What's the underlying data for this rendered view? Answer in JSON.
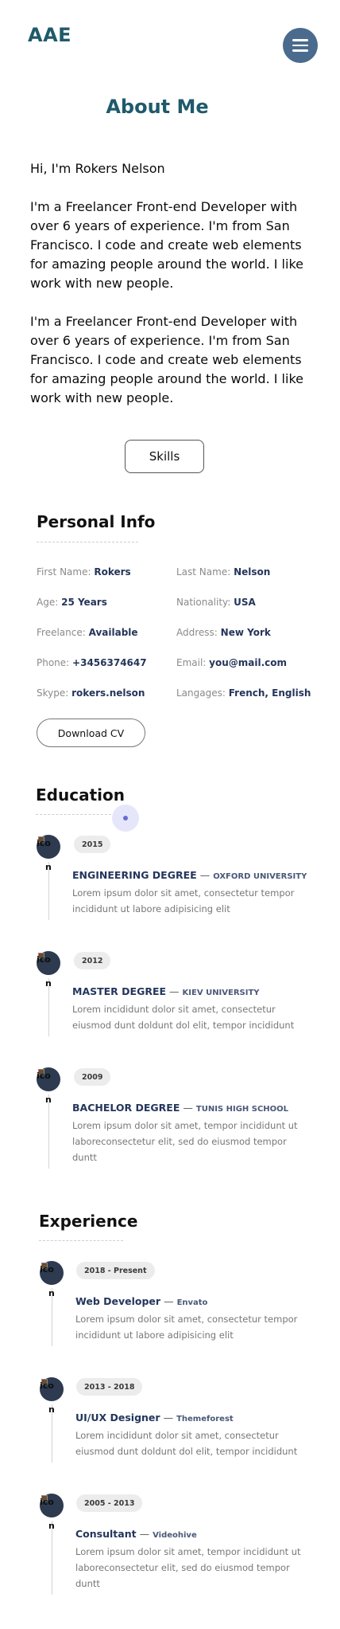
{
  "header": {
    "logo": "AAE",
    "menu_icon": "hamburger-menu-icon"
  },
  "about": {
    "title": "About Me",
    "greeting": "Hi, I'm Rokers Nelson",
    "paragraph1": "I'm a Freelancer Front-end Developer with over 6 years of experience. I'm from San Francisco. I code and create web elements for amazing people around the world. I like work with new people.",
    "paragraph2": "I'm a Freelancer Front-end Developer with over 6 years of experience. I'm from San Francisco. I code and create web elements for amazing people around the world. I like work with new people.",
    "skills_button": "Skills"
  },
  "personal_info": {
    "title": "Personal Info",
    "fields": [
      {
        "label": "First Name:",
        "value": "Rokers"
      },
      {
        "label": "Last Name:",
        "value": "Nelson"
      },
      {
        "label": "Age:",
        "value": "25 Years"
      },
      {
        "label": "Nationality:",
        "value": "USA"
      },
      {
        "label": "Freelance:",
        "value": "Available"
      },
      {
        "label": "Address:",
        "value": "New York"
      },
      {
        "label": "Phone:",
        "value": "+3456374647"
      },
      {
        "label": "Email:",
        "value": "you@mail.com"
      },
      {
        "label": "Skype:",
        "value": "rokers.nelson"
      },
      {
        "label": "Langages:",
        "value": "French, English"
      }
    ],
    "download_button": "Download CV"
  },
  "education": {
    "title": "Education",
    "items": [
      {
        "year": "2015",
        "degree": "ENGINEERING DEGREE",
        "school": "OXFORD UNIVERSITY",
        "description": "Lorem ipsum dolor sit amet, consectetur tempor incididunt ut labore adipisicing elit",
        "icon_alt": "ico",
        "icon_tail": "n"
      },
      {
        "year": "2012",
        "degree": "MASTER DEGREE",
        "school": "KIEV UNIVERSITY",
        "description": "Lorem incididunt dolor sit amet, consectetur eiusmod dunt doldunt dol elit, tempor incididunt",
        "icon_alt": "ico",
        "icon_tail": "n"
      },
      {
        "year": "2009",
        "degree": "BACHELOR DEGREE",
        "school": "TUNIS HIGH SCHOOL",
        "description": "Lorem ipsum dolor sit amet, tempor incididunt ut laboreconsectetur elit, sed do eiusmod tempor duntt",
        "icon_alt": "ico",
        "icon_tail": "n"
      }
    ]
  },
  "experience": {
    "title": "Experience",
    "items": [
      {
        "period": "2018 - Present",
        "role": "Web Developer",
        "company": "Envato",
        "description": "Lorem ipsum dolor sit amet, consectetur tempor incididunt ut labore adipisicing elit",
        "icon_alt": "ico",
        "icon_tail": "n"
      },
      {
        "period": "2013 - 2018",
        "role": "UI/UX Designer",
        "company": "Themeforest",
        "description": "Lorem incididunt dolor sit amet, consectetur eiusmod dunt doldunt dol elit, tempor incididunt",
        "icon_alt": "ico",
        "icon_tail": "n"
      },
      {
        "period": "2005 - 2013",
        "role": "Consultant",
        "company": "Videohive",
        "description": "Lorem ipsum dolor sit amet, tempor incididunt ut laboreconsectetur elit, sed do eiusmod tempor duntt",
        "icon_alt": "ico",
        "icon_tail": "n"
      }
    ]
  }
}
